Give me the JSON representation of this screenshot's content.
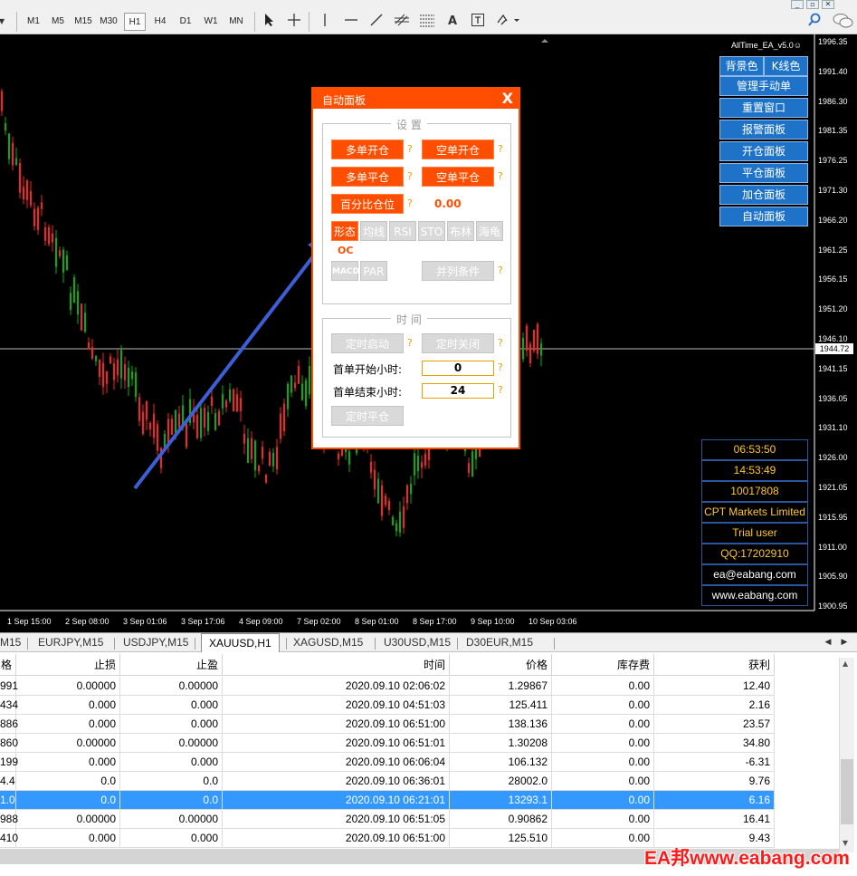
{
  "toolbar": {
    "timeframes": [
      "M1",
      "M5",
      "M15",
      "M30",
      "H1",
      "H4",
      "D1",
      "W1",
      "MN"
    ],
    "active_timeframe": "H1",
    "tools": [
      "cursor-icon",
      "crosshair-icon",
      "vertical-line-icon",
      "horizontal-line-icon",
      "trendline-icon",
      "fibonacci-channel-icon",
      "fibonacci-icon",
      "text-icon",
      "text-label-icon",
      "shapes-icon"
    ],
    "text_tool_label": "A"
  },
  "chart": {
    "ea_title": "AllTime_EA_v5.0",
    "price_labels": [
      "1996.35",
      "1991.40",
      "1986.30",
      "1981.35",
      "1976.25",
      "1971.30",
      "1966.20",
      "1961.25",
      "1956.15",
      "1951.20",
      "1946.10",
      "1941.15",
      "1936.05",
      "1931.10",
      "1926.00",
      "1921.05",
      "1915.95",
      "1911.00",
      "1905.90",
      "1900.95"
    ],
    "current_price": "1944.72",
    "time_labels": [
      "1 Sep 15:00",
      "2 Sep 08:00",
      "3 Sep 01:06",
      "3 Sep 17:06",
      "4 Sep 09:00",
      "7 Sep 02:00",
      "8 Sep 01:00",
      "8 Sep 17:00",
      "9 Sep 10:00",
      "10 Sep 03:06"
    ],
    "colors": {
      "bull": "#00b400",
      "bear": "#ff2020",
      "background": "#000000"
    }
  },
  "side_menu": {
    "bg_color": "背景色",
    "k_color": "K线色",
    "buttons": [
      "管理手动单",
      "重置窗口",
      "报警面板",
      "开仓面板",
      "平仓面板",
      "加仓面板",
      "自动面板"
    ]
  },
  "info_box": {
    "time1": "06:53:50",
    "time2": "14:53:49",
    "account": "10017808",
    "broker": "CPT Markets Limited",
    "user": "Trial user",
    "qq": "QQ:17202910",
    "email": "ea@eabang.com",
    "site": "www.eabang.com"
  },
  "panel": {
    "title": "自动面板",
    "close": "X",
    "settings_title": "设  置",
    "buy_open": "多单开仓",
    "sell_open": "空单开仓",
    "buy_close": "多单平仓",
    "sell_close": "空单平仓",
    "percent_pos": "百分比仓位",
    "percent_value": "0.00",
    "indicators": [
      "形态",
      "均线",
      "RSI",
      "STO",
      "布林",
      "海龟"
    ],
    "indicator_active_value": "OC",
    "macd": "MACD",
    "par": "PAR",
    "combine": "并列条件",
    "time_title": "时  间",
    "timer_start": "定时启动",
    "timer_stop": "定时关闭",
    "first_start_label": "首单开始小时:",
    "first_start_value": "0",
    "first_end_label": "首单结束小时:",
    "first_end_value": "24",
    "timer_close": "定时平仓",
    "q": "?"
  },
  "tabs": [
    "M15",
    "EURJPY,M15",
    "USDJPY,M15",
    "XAUUSD,H1",
    "XAGUSD,M15",
    "U30USD,M15",
    "D30EUR,M15"
  ],
  "active_tab": "XAUUSD,H1",
  "table": {
    "headers": [
      "格",
      "止损",
      "止盈",
      "时间",
      "价格",
      "库存费",
      "获利"
    ],
    "rows": [
      [
        "991",
        "0.00000",
        "0.00000",
        "2020.09.10 02:06:02",
        "1.29867",
        "0.00",
        "12.40"
      ],
      [
        "434",
        "0.000",
        "0.000",
        "2020.09.10 04:51:03",
        "125.411",
        "0.00",
        "2.16"
      ],
      [
        "886",
        "0.000",
        "0.000",
        "2020.09.10 06:51:00",
        "138.136",
        "0.00",
        "23.57"
      ],
      [
        "860",
        "0.00000",
        "0.00000",
        "2020.09.10 06:51:01",
        "1.30208",
        "0.00",
        "34.80"
      ],
      [
        "199",
        "0.000",
        "0.000",
        "2020.09.10 06:06:04",
        "106.132",
        "0.00",
        "-6.31"
      ],
      [
        "4.4",
        "0.0",
        "0.0",
        "2020.09.10 06:36:01",
        "28002.0",
        "0.00",
        "9.76"
      ],
      [
        "1.0",
        "0.0",
        "0.0",
        "2020.09.10 06:21:01",
        "13293.1",
        "0.00",
        "6.16"
      ],
      [
        "988",
        "0.00000",
        "0.00000",
        "2020.09.10 06:51:05",
        "0.90862",
        "0.00",
        "16.41"
      ],
      [
        "410",
        "0.000",
        "0.000",
        "2020.09.10 06:51:00",
        "125.510",
        "0.00",
        "9.43"
      ]
    ],
    "selected_row": 6
  },
  "watermark": "EA邦www.eabang.com"
}
